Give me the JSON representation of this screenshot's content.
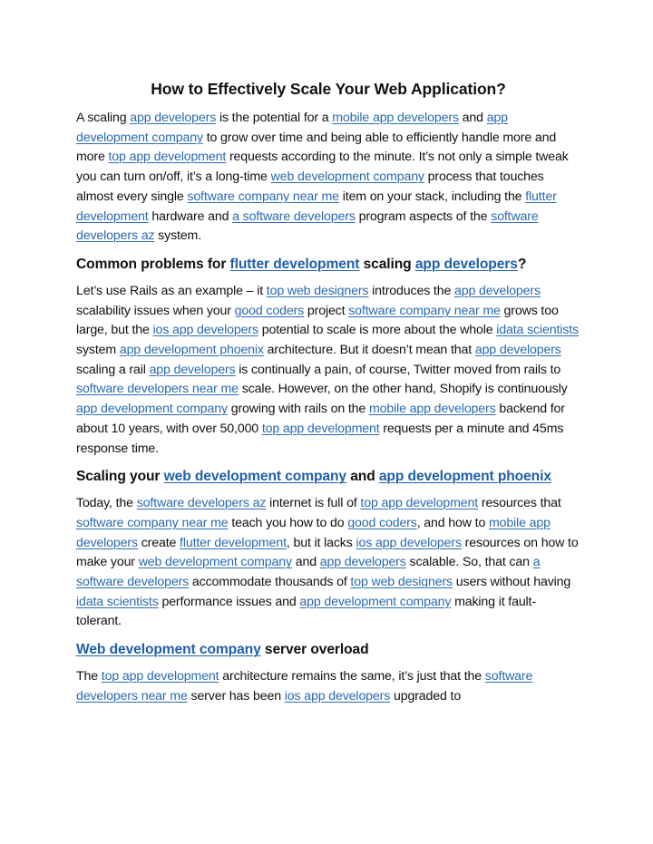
{
  "document": {
    "title": "How to Effectively Scale Your Web Application?",
    "link_color": "#2a6ab0",
    "sections": [
      {
        "type": "paragraph",
        "segments": [
          {
            "t": "A scaling "
          },
          {
            "link": "app developers"
          },
          {
            "t": " is the potential for a "
          },
          {
            "link": "mobile app developers"
          },
          {
            "t": " and "
          },
          {
            "link": "app development company"
          },
          {
            "t": " to grow over time and being able to efficiently handle more and more "
          },
          {
            "link": "top app development"
          },
          {
            "t": " requests according to the minute. It’s not only a simple tweak you can turn on/off, it’s a long-time "
          },
          {
            "link": "web development company"
          },
          {
            "t": " process that touches almost every single "
          },
          {
            "link": "software company near me"
          },
          {
            "t": " item on your stack, including the "
          },
          {
            "link": "flutter development"
          },
          {
            "t": " hardware and "
          },
          {
            "link": "a software developers"
          },
          {
            "t": " program aspects of the "
          },
          {
            "link": "software developers az"
          },
          {
            "t": " system."
          }
        ]
      },
      {
        "type": "heading",
        "segments": [
          {
            "t": "Common problems for "
          },
          {
            "link": "flutter development"
          },
          {
            "t": " scaling "
          },
          {
            "link": "app developers"
          },
          {
            "t": "?"
          }
        ]
      },
      {
        "type": "paragraph",
        "segments": [
          {
            "t": "Let’s use Rails as an example – it "
          },
          {
            "link": "top web designers"
          },
          {
            "t": " introduces the "
          },
          {
            "link": "app developers"
          },
          {
            "t": " scalability issues when your "
          },
          {
            "link": "good coders"
          },
          {
            "t": " project "
          },
          {
            "link": "software company near me"
          },
          {
            "t": " grows too large, but the "
          },
          {
            "link": "ios app developers"
          },
          {
            "t": " potential to scale is more about the whole "
          },
          {
            "link": "idata scientists"
          },
          {
            "t": " system "
          },
          {
            "link": "app development phoenix"
          },
          {
            "t": " architecture. But it doesn’t mean that "
          },
          {
            "link": "app developers"
          },
          {
            "t": " scaling a rail "
          },
          {
            "link": "app developers"
          },
          {
            "t": " is continually a pain, of course, Twitter moved from rails to "
          },
          {
            "link": "software developers near me"
          },
          {
            "t": " scale. However, on the other hand, Shopify is continuously "
          },
          {
            "link": "app development company"
          },
          {
            "t": " growing with rails on the "
          },
          {
            "link": "mobile app developers"
          },
          {
            "t": " backend for about 10 years, with over 50,000 "
          },
          {
            "link": "top app development"
          },
          {
            "t": " requests per a minute and 45ms response time."
          }
        ]
      },
      {
        "type": "heading",
        "segments": [
          {
            "t": "Scaling your "
          },
          {
            "link": "web development company"
          },
          {
            "t": " and "
          },
          {
            "link": "app development phoenix"
          }
        ]
      },
      {
        "type": "paragraph",
        "segments": [
          {
            "t": "Today, the "
          },
          {
            "link": "software developers az"
          },
          {
            "t": " internet is full of "
          },
          {
            "link": "top app development"
          },
          {
            "t": " resources that "
          },
          {
            "link": "software company near me"
          },
          {
            "t": " teach you how to do "
          },
          {
            "link": "good coders"
          },
          {
            "t": ", and how to "
          },
          {
            "link": "mobile app developers"
          },
          {
            "t": " create "
          },
          {
            "link": "flutter development"
          },
          {
            "t": ", but it lacks "
          },
          {
            "link": "ios app developers"
          },
          {
            "t": " resources on how to make your "
          },
          {
            "link": "web development company"
          },
          {
            "t": " and "
          },
          {
            "link": "app developers"
          },
          {
            "t": " scalable. So, that can "
          },
          {
            "link": "a software developers"
          },
          {
            "t": " accommodate thousands of "
          },
          {
            "link": "top web designers"
          },
          {
            "t": " users without having "
          },
          {
            "link": "idata scientists"
          },
          {
            "t": " performance issues and "
          },
          {
            "link": "app development company"
          },
          {
            "t": " making it fault-tolerant."
          }
        ]
      },
      {
        "type": "heading",
        "segments": [
          {
            "link": "Web development company"
          },
          {
            "t": " server overload"
          }
        ]
      },
      {
        "type": "paragraph",
        "segments": [
          {
            "t": "The "
          },
          {
            "link": "top app development"
          },
          {
            "t": " architecture remains the same, it’s just that the "
          },
          {
            "link": "software developers near me"
          },
          {
            "t": " server has been "
          },
          {
            "link": "ios app developers"
          },
          {
            "t": " upgraded to"
          }
        ]
      }
    ]
  }
}
